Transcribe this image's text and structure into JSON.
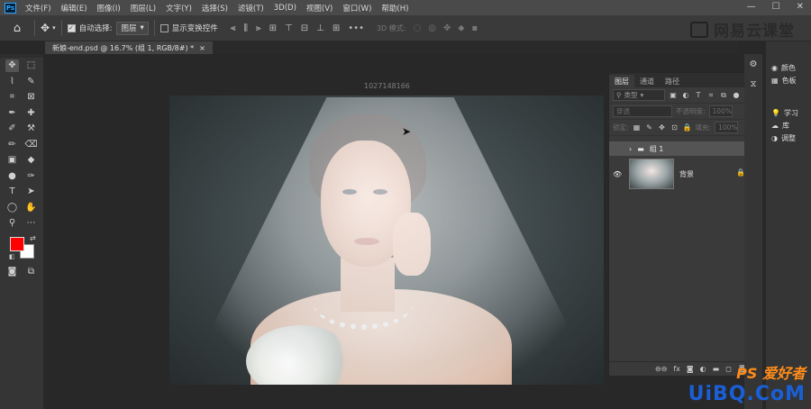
{
  "menu": {
    "logo": "Ps",
    "items": [
      "文件(F)",
      "编辑(E)",
      "图像(I)",
      "图层(L)",
      "文字(Y)",
      "选择(S)",
      "滤镜(T)",
      "3D(D)",
      "视图(V)",
      "窗口(W)",
      "帮助(H)"
    ],
    "window_controls": [
      "—",
      "☐",
      "✕"
    ]
  },
  "options": {
    "home_icon": "⌂",
    "move_icon": "✥",
    "auto_select_label": "自动选择:",
    "auto_select_value": "图层",
    "show_transform_label": "显示变换控件",
    "mode3d_label": "3D 模式:",
    "brand": "网易云课堂"
  },
  "document": {
    "tab_title": "新娘-end.psd @ 16.7% (组 1, RGB/8#) *",
    "tab_close": "×",
    "canvas_label": "1027148166"
  },
  "tools": {
    "rows": [
      [
        "✥",
        "⬚"
      ],
      [
        "⌇",
        "✎"
      ],
      [
        "⌗",
        "⊠"
      ],
      [
        "✒",
        "✚"
      ],
      [
        "✐",
        "⚒"
      ],
      [
        "✏",
        "⌫"
      ],
      [
        "▣",
        "◆"
      ],
      [
        "●",
        "✑"
      ],
      [
        "T",
        "➤"
      ],
      [
        "◯",
        "✋"
      ],
      [
        "⚲",
        "⋯"
      ]
    ],
    "swap_icon": "⇄",
    "reset_icon": "◧",
    "fg_color": "#ff0000",
    "bg_color": "#ffffff"
  },
  "layers_panel": {
    "tabs": [
      "图层",
      "通道",
      "路径"
    ],
    "kind_label": "类型",
    "blend_mode": "穿透",
    "opacity_label": "不透明度:",
    "opacity_value": "100%",
    "lock_label": "锁定:",
    "fill_label": "填充:",
    "fill_value": "100%",
    "layers": [
      {
        "name": "组 1",
        "type": "group"
      },
      {
        "name": "背景",
        "type": "background"
      }
    ],
    "footer_icons": [
      "⊖⊖",
      "fx",
      "◙",
      "◐",
      "▬",
      "◻",
      "🗑"
    ]
  },
  "right_dock": {
    "panels": [
      {
        "label": "颜色",
        "icon": "◉"
      },
      {
        "label": "色板",
        "icon": "▦"
      },
      {
        "label": "学习",
        "icon": "💡"
      },
      {
        "label": "库",
        "icon": "☁"
      },
      {
        "label": "调整",
        "icon": "◑"
      }
    ]
  },
  "watermark": {
    "ps_text": "PS 爱好者",
    "site_text": "UiBQ.CoM"
  }
}
